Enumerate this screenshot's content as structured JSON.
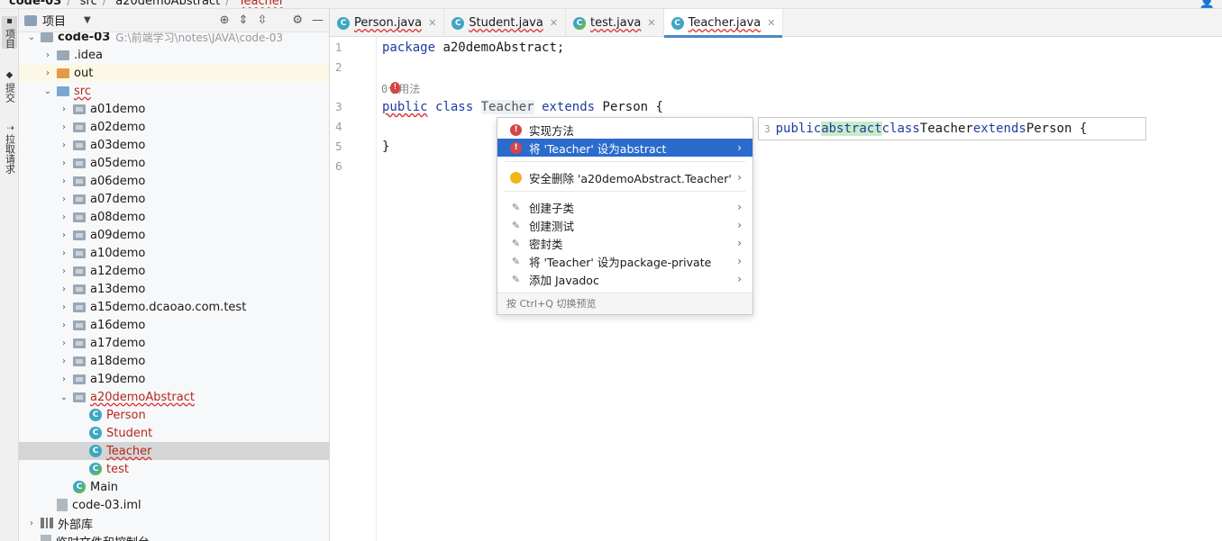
{
  "breadcrumb": [
    "code-03",
    "src",
    "a20demoAbstract",
    "Teacher"
  ],
  "vstrip": [
    {
      "label": "项目",
      "glyph": "▪"
    },
    {
      "label": "提交",
      "glyph": "◆"
    },
    {
      "label": "拉取请求",
      "glyph": "⇡"
    }
  ],
  "project": {
    "title": "项目",
    "tree": [
      {
        "label": "code-03",
        "extra": "G:\\前端学习\\notes\\JAVA\\code-03",
        "depth": 0,
        "icon": "folder",
        "arrow": "open"
      },
      {
        "label": ".idea",
        "depth": 1,
        "icon": "folder",
        "arrow": "closed"
      },
      {
        "label": "out",
        "depth": 1,
        "icon": "folder-orange",
        "arrow": "closed",
        "highlight": "yellow"
      },
      {
        "label": "src",
        "depth": 1,
        "icon": "folder-blue",
        "arrow": "open",
        "error": true
      },
      {
        "label": "a01demo",
        "depth": 2,
        "icon": "package",
        "arrow": "closed"
      },
      {
        "label": "a02demo",
        "depth": 2,
        "icon": "package",
        "arrow": "closed"
      },
      {
        "label": "a03demo",
        "depth": 2,
        "icon": "package",
        "arrow": "closed"
      },
      {
        "label": "a05demo",
        "depth": 2,
        "icon": "package",
        "arrow": "closed"
      },
      {
        "label": "a06demo",
        "depth": 2,
        "icon": "package",
        "arrow": "closed"
      },
      {
        "label": "a07demo",
        "depth": 2,
        "icon": "package",
        "arrow": "closed"
      },
      {
        "label": "a08demo",
        "depth": 2,
        "icon": "package",
        "arrow": "closed"
      },
      {
        "label": "a09demo",
        "depth": 2,
        "icon": "package",
        "arrow": "closed"
      },
      {
        "label": "a10demo",
        "depth": 2,
        "icon": "package",
        "arrow": "closed"
      },
      {
        "label": "a12demo",
        "depth": 2,
        "icon": "package",
        "arrow": "closed"
      },
      {
        "label": "a13demo",
        "depth": 2,
        "icon": "package",
        "arrow": "closed"
      },
      {
        "label": "a15demo.dcaoao.com.test",
        "depth": 2,
        "icon": "package",
        "arrow": "closed"
      },
      {
        "label": "a16demo",
        "depth": 2,
        "icon": "package",
        "arrow": "closed"
      },
      {
        "label": "a17demo",
        "depth": 2,
        "icon": "package",
        "arrow": "closed"
      },
      {
        "label": "a18demo",
        "depth": 2,
        "icon": "package",
        "arrow": "closed"
      },
      {
        "label": "a19demo",
        "depth": 2,
        "icon": "package",
        "arrow": "closed"
      },
      {
        "label": "a20demoAbstract",
        "depth": 2,
        "icon": "package",
        "arrow": "open",
        "error": true
      },
      {
        "label": "Person",
        "depth": 3,
        "icon": "class",
        "arrow": "none",
        "redtext": true
      },
      {
        "label": "Student",
        "depth": 3,
        "icon": "class",
        "arrow": "none",
        "redtext": true
      },
      {
        "label": "Teacher",
        "depth": 3,
        "icon": "class",
        "arrow": "none",
        "redtext": true,
        "error": true,
        "selected": true
      },
      {
        "label": "test",
        "depth": 3,
        "icon": "class-run",
        "arrow": "none",
        "redtext": true
      },
      {
        "label": "Main",
        "depth": 2,
        "icon": "class-run",
        "arrow": "none"
      },
      {
        "label": "code-03.iml",
        "depth": 1,
        "icon": "iml",
        "arrow": "none"
      },
      {
        "label": "外部库",
        "depth": 0,
        "icon": "library",
        "arrow": "closed"
      },
      {
        "label": "临时文件和控制台",
        "depth": 0,
        "icon": "scratch",
        "arrow": "none"
      }
    ]
  },
  "tabs": [
    {
      "label": "Person.java",
      "active": false,
      "error": true,
      "run": false
    },
    {
      "label": "Student.java",
      "active": false,
      "error": true,
      "run": false
    },
    {
      "label": "test.java",
      "active": false,
      "error": true,
      "run": true
    },
    {
      "label": "Teacher.java",
      "active": true,
      "error": true,
      "run": false
    }
  ],
  "editor": {
    "line_numbers": [
      "1",
      "2",
      "3",
      "4",
      "5",
      "6"
    ],
    "lines": {
      "l1": "package a20demoAbstract;",
      "usage": "0个用法",
      "l3_public": "public",
      "l3_class": "class",
      "l3_name": "Teacher",
      "l3_extends": "extends",
      "l3_rest": "Person {",
      "l5": "}"
    }
  },
  "context_menu": {
    "items": [
      {
        "label": "实现方法",
        "icon": "error-bulb",
        "chevron": false,
        "selected": false
      },
      {
        "label": "将 'Teacher' 设为abstract",
        "icon": "error-bulb",
        "chevron": true,
        "selected": true
      },
      {
        "label": "安全删除 'a20demoAbstract.Teacher'",
        "icon": "bulb",
        "chevron": true,
        "selected": false
      },
      {
        "label": "创建子类",
        "icon": "pen",
        "chevron": true,
        "selected": false
      },
      {
        "label": "创建测试",
        "icon": "pen",
        "chevron": true,
        "selected": false
      },
      {
        "label": "密封类",
        "icon": "pen",
        "chevron": true,
        "selected": false
      },
      {
        "label": "将 'Teacher' 设为package-private",
        "icon": "pen",
        "chevron": true,
        "selected": false
      },
      {
        "label": "添加 Javadoc",
        "icon": "pen",
        "chevron": true,
        "selected": false
      }
    ],
    "footer": "按 Ctrl+Q 切换预览"
  },
  "preview": {
    "line_no": "3",
    "public": "public",
    "abstract": "abstract",
    "class": "class",
    "name": "Teacher",
    "extends": "extends",
    "rest": "Person {"
  }
}
